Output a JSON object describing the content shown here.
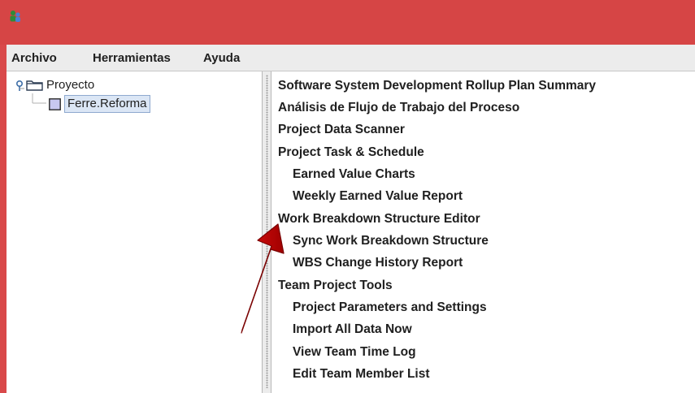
{
  "window": {
    "accent_color": "#d64545",
    "title_icon": "app-people-icon"
  },
  "menubar": {
    "items": [
      "Archivo",
      "Herramientas",
      "Ayuda"
    ]
  },
  "tree": {
    "root": {
      "label": "Proyecto",
      "icon": "folder-icon",
      "expanded": true
    },
    "child": {
      "label": "Ferre.Reforma",
      "icon": "node-square-icon",
      "selected": true
    }
  },
  "scripts": {
    "items": [
      {
        "label": "Software System Development Rollup Plan Summary",
        "indent": 0
      },
      {
        "label": "Análisis de Flujo de Trabajo del Proceso",
        "indent": 0
      },
      {
        "label": "Project Data Scanner",
        "indent": 0
      },
      {
        "label": "Project Task & Schedule",
        "indent": 0
      },
      {
        "label": "Earned Value Charts",
        "indent": 1
      },
      {
        "label": "Weekly Earned Value Report",
        "indent": 1
      },
      {
        "label": "Work Breakdown Structure Editor",
        "indent": 0
      },
      {
        "label": "Sync Work Breakdown Structure",
        "indent": 1
      },
      {
        "label": "WBS Change History Report",
        "indent": 1
      },
      {
        "label": "Team Project Tools",
        "indent": 0
      },
      {
        "label": "Project Parameters and Settings",
        "indent": 1
      },
      {
        "label": "Import All Data Now",
        "indent": 1
      },
      {
        "label": "View Team Time Log",
        "indent": 1
      },
      {
        "label": "Edit Team Member List",
        "indent": 1
      }
    ]
  },
  "annotation": {
    "arrow_color": "#c00000",
    "icon": "red-arrow-icon"
  }
}
